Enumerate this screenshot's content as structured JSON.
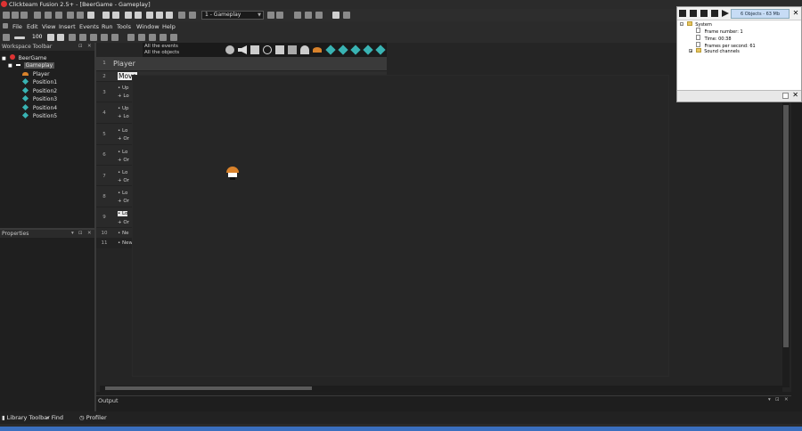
{
  "window": {
    "title": "Clickteam Fusion 2.5+ - [BeerGame - Gameplay]"
  },
  "frame_selector": {
    "value": "1 - Gameplay"
  },
  "zoom": {
    "value": "100"
  },
  "menu": [
    "File",
    "Edit",
    "View",
    "Insert",
    "Events",
    "Run",
    "Tools",
    "Window",
    "Help"
  ],
  "workspace": {
    "title": "Workspace Toolbar",
    "tree": [
      {
        "label": "BeerGame",
        "level": 0,
        "icon": "app-icon"
      },
      {
        "label": "Gameplay",
        "level": 1,
        "icon": "frame-icon"
      },
      {
        "label": "Player",
        "level": 2,
        "icon": "player-icon"
      },
      {
        "label": "Position1",
        "level": 2,
        "icon": "diamond-icon"
      },
      {
        "label": "Position2",
        "level": 2,
        "icon": "diamond-icon"
      },
      {
        "label": "Position3",
        "level": 2,
        "icon": "diamond-icon"
      },
      {
        "label": "Position4",
        "level": 2,
        "icon": "diamond-icon"
      },
      {
        "label": "Position5",
        "level": 2,
        "icon": "diamond-icon"
      }
    ]
  },
  "properties": {
    "title": "Properties"
  },
  "event_editor": {
    "header_all_events": "All the events",
    "header_all_objects": "All the objects",
    "rows": [
      {
        "num": "1",
        "text": "Player",
        "type": "group"
      },
      {
        "num": "2",
        "text": "Move",
        "type": "comment"
      },
      {
        "num": "3",
        "lines": [
          "Up",
          "Lo"
        ]
      },
      {
        "num": "4",
        "lines": [
          "Up",
          "Lo"
        ]
      },
      {
        "num": "5",
        "lines": [
          "Lo",
          "Or"
        ]
      },
      {
        "num": "6",
        "lines": [
          "Lo",
          "Or"
        ]
      },
      {
        "num": "7",
        "lines": [
          "Lo",
          "Or"
        ]
      },
      {
        "num": "8",
        "lines": [
          "Lo",
          "Or"
        ]
      },
      {
        "num": "9",
        "lines": [
          "Lo",
          "Or"
        ]
      },
      {
        "num": "10",
        "lines": [
          "Ne"
        ]
      },
      {
        "num": "11",
        "lines": [
          "New c"
        ]
      }
    ]
  },
  "output": {
    "title": "Output"
  },
  "bottom_tabs": [
    "Library Toolbar",
    "Find",
    "Profiler"
  ],
  "debugger": {
    "status": "6 Objects - 63 Mb",
    "tree": [
      {
        "label": "System",
        "level": 0
      },
      {
        "label": "Frame number: 1",
        "level": 1
      },
      {
        "label": "Time: 00:38",
        "level": 1
      },
      {
        "label": "Frames per second: 61",
        "level": 1
      },
      {
        "label": "Sound channels",
        "level": 0
      }
    ]
  },
  "colors": {
    "accent": "#3a6fbf",
    "diamond": "#39b3b3",
    "background": "#1e1e1e"
  }
}
